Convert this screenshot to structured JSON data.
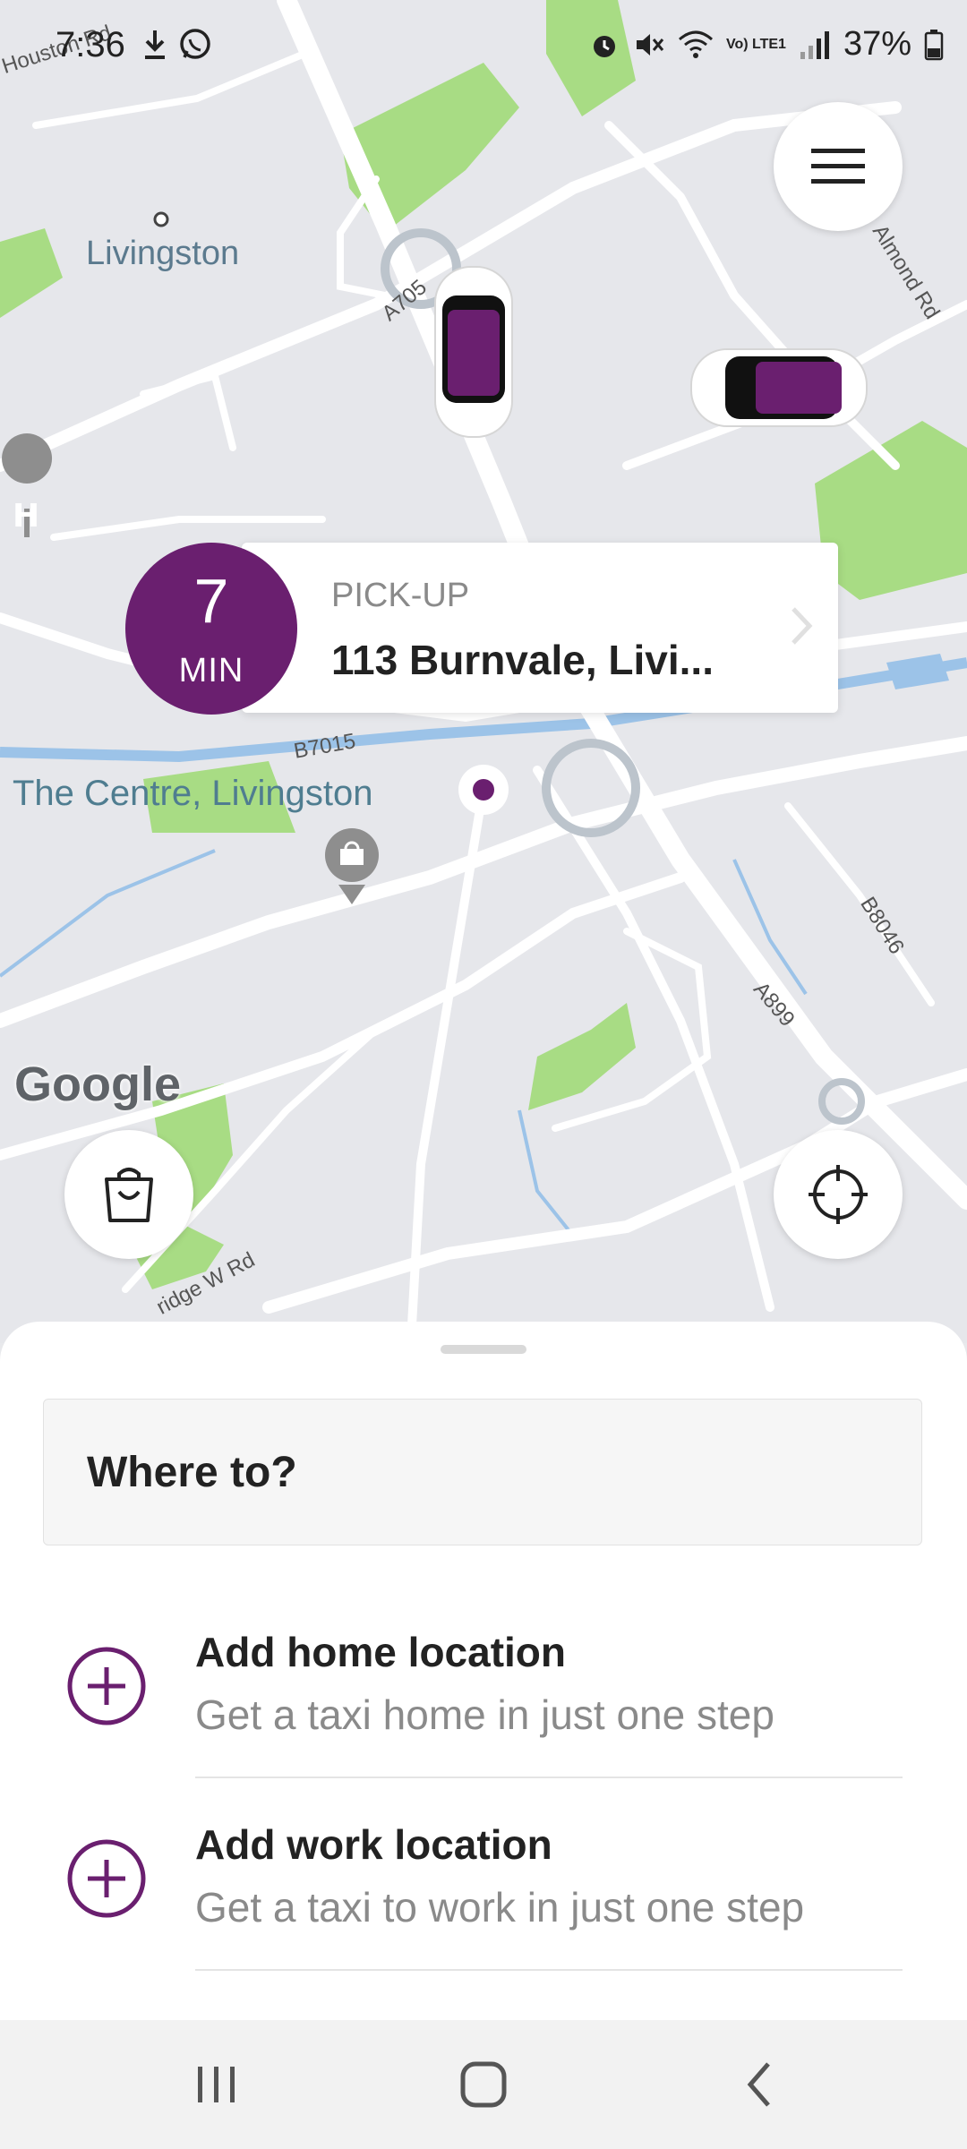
{
  "status_bar": {
    "time": "7:36",
    "battery": "37%",
    "network": "Vo) LTE1"
  },
  "map": {
    "labels": {
      "livingston": "Livingston",
      "the_centre": "The Centre, Livingston",
      "houston_rd": "Houston Rd",
      "almond_rd": "Almond Rd",
      "a705": "A705",
      "b7015": "B7015",
      "b8046": "B8046",
      "a899": "A899",
      "bridge_w_rd": "ridge W Rd",
      "google": "Google"
    },
    "colors": {
      "accent": "#6a1f6f",
      "park": "#a8dc84",
      "water": "#9cc3e8"
    }
  },
  "pickup": {
    "eta_value": "7",
    "eta_unit": "MIN",
    "label": "PICK-UP",
    "address": "113 Burnvale, Livi..."
  },
  "sheet": {
    "search_placeholder": "Where to?",
    "items": [
      {
        "title": "Add home location",
        "subtitle": "Get a taxi home in just one step",
        "icon": "plus-circle-icon"
      },
      {
        "title": "Add work location",
        "subtitle": "Get a taxi to work in just one step",
        "icon": "plus-circle-icon"
      }
    ]
  },
  "icons": {
    "menu": "hamburger-menu-icon",
    "shop": "shopping-bag-icon",
    "locate": "crosshair-icon"
  }
}
